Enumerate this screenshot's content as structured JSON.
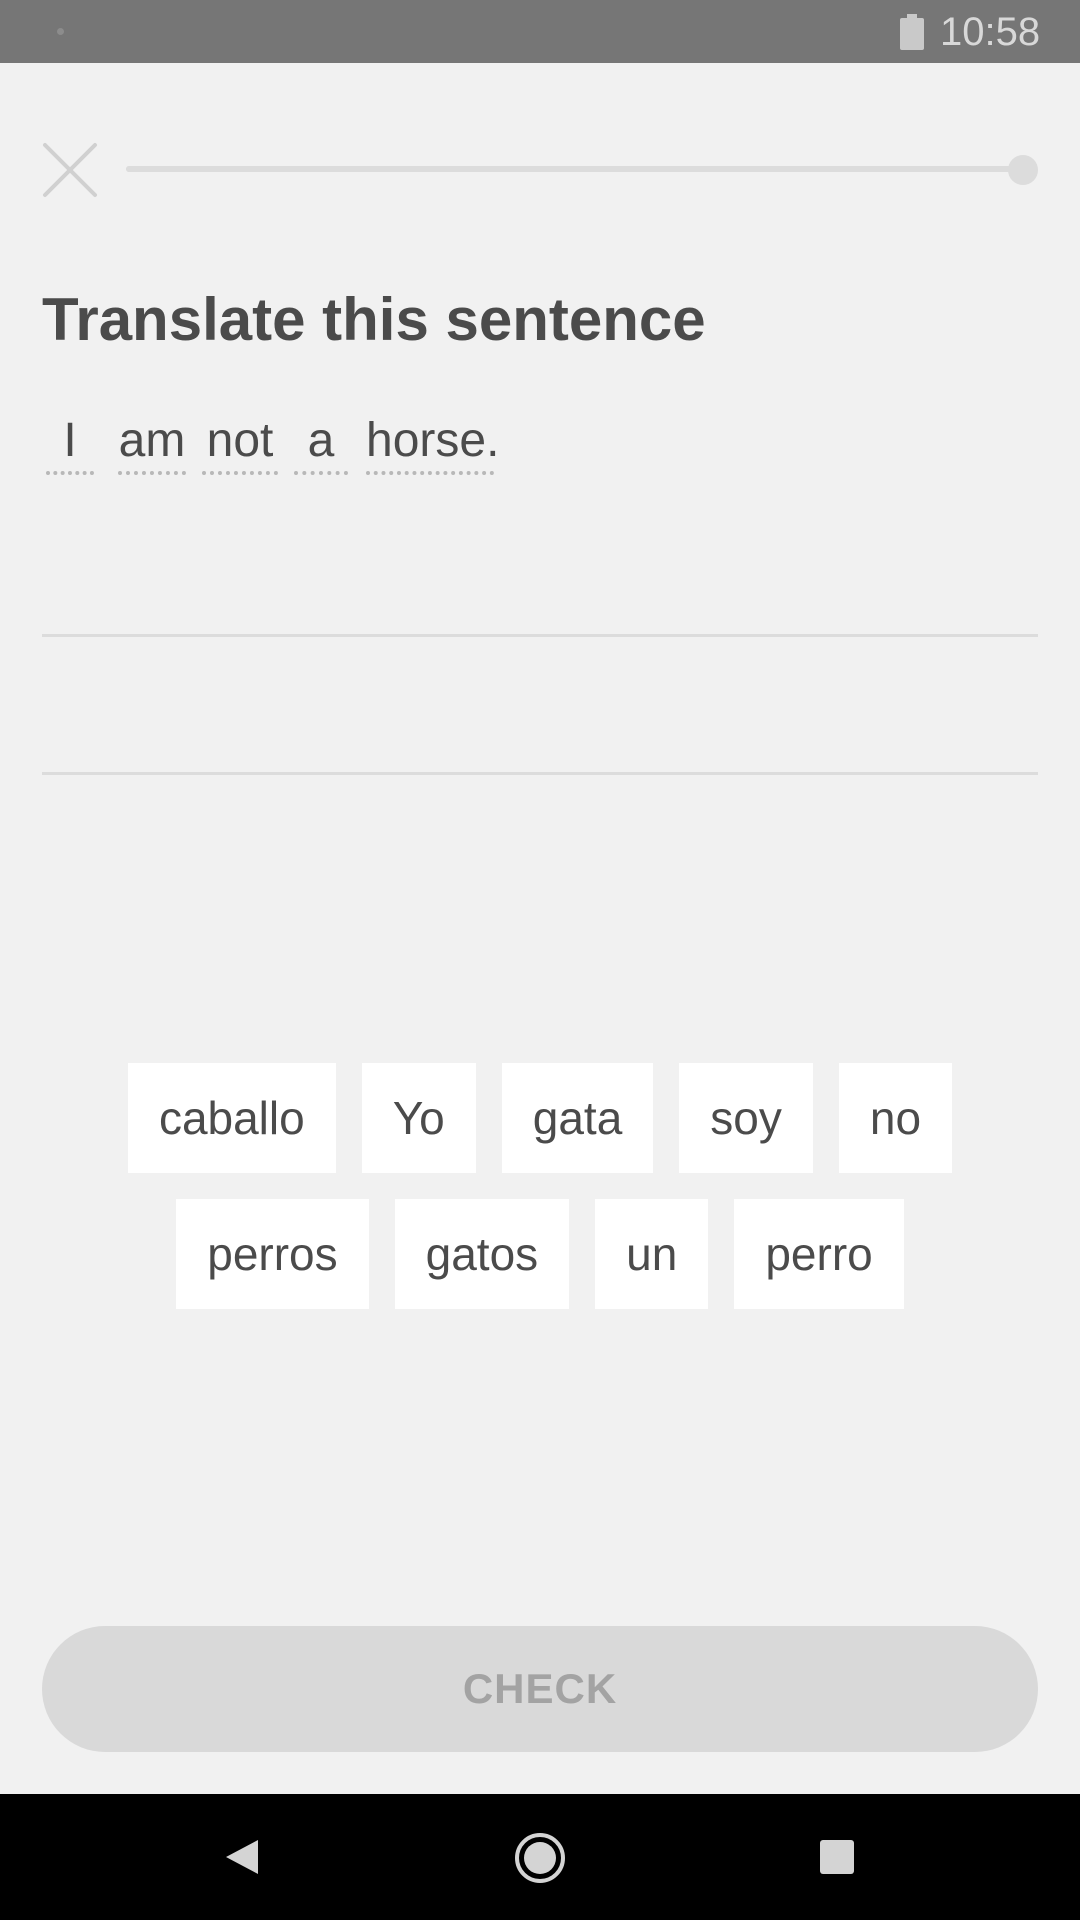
{
  "status_bar": {
    "time": "10:58",
    "battery_icon": "battery-icon"
  },
  "header": {
    "close_icon": "close-icon",
    "progress_fraction": 1.0
  },
  "challenge": {
    "title": "Translate this sentence",
    "prompt_words": [
      "I",
      "am",
      "not",
      "a",
      "horse."
    ]
  },
  "word_bank": {
    "row1": [
      "caballo",
      "Yo",
      "gata",
      "soy",
      "no"
    ],
    "row2": [
      "perros",
      "gatos",
      "un",
      "perro"
    ]
  },
  "footer": {
    "check_label": "CHECK"
  },
  "nav_bar": {
    "back_icon": "back-icon",
    "home_icon": "home-icon",
    "recents_icon": "recents-icon"
  },
  "colors": {
    "background": "#f1f1f1",
    "text": "#4b4b4b",
    "check_disabled_bg": "#d9d9d9",
    "check_disabled_text": "#a3a3a3",
    "status_bar": "#767676"
  }
}
